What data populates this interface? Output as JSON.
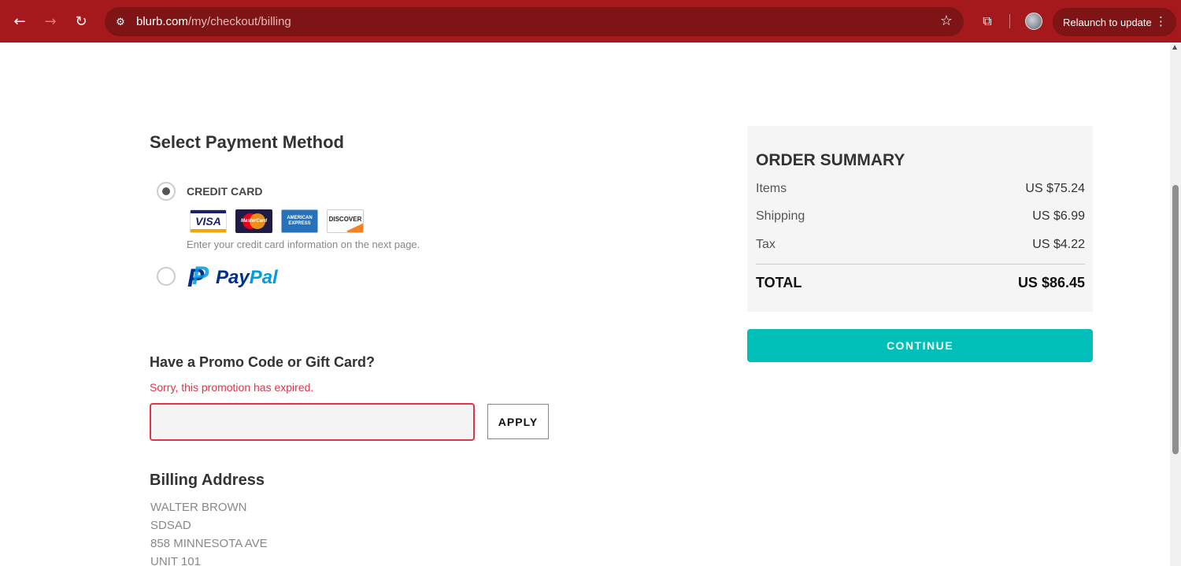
{
  "browser": {
    "url_host": "blurb.com",
    "url_path": "/my/checkout/billing",
    "relaunch_label": "Relaunch to update",
    "icons": {
      "back": "←",
      "forward": "→",
      "reload": "↻",
      "site_info": "⚙",
      "bookmark": "☆",
      "extensions": "⧉",
      "menu": "⋮"
    }
  },
  "payment": {
    "title": "Select Payment Method",
    "credit_card_label": "CREDIT CARD",
    "credit_card_selected": true,
    "card_brands": {
      "visa": "VISA",
      "mastercard": "MasterCard",
      "amex_line1": "AMERICAN",
      "amex_line2": "EXPRESS",
      "discover": "DISCOVER"
    },
    "credit_card_hint": "Enter your credit card information on the next page.",
    "paypal_pay": "Pay",
    "paypal_pal": "Pal",
    "paypal_mark": "P"
  },
  "promo": {
    "title": "Have a Promo Code or Gift Card?",
    "error": "Sorry, this promotion has expired.",
    "input_value": "",
    "apply_label": "APPLY"
  },
  "billing": {
    "title": "Billing Address",
    "lines": [
      "WALTER BROWN",
      "SDSAD",
      "858 MINNESOTA AVE",
      "UNIT 101"
    ]
  },
  "summary": {
    "title": "ORDER SUMMARY",
    "items_label": "Items",
    "items_value": "US $75.24",
    "shipping_label": "Shipping",
    "shipping_value": "US $6.99",
    "tax_label": "Tax",
    "tax_value": "US $4.22",
    "total_label": "TOTAL",
    "total_value": "US $86.45",
    "continue_label": "CONTINUE"
  },
  "colors": {
    "chrome": "#a5191c",
    "accent": "#00bfb9",
    "error": "#e0344a"
  }
}
